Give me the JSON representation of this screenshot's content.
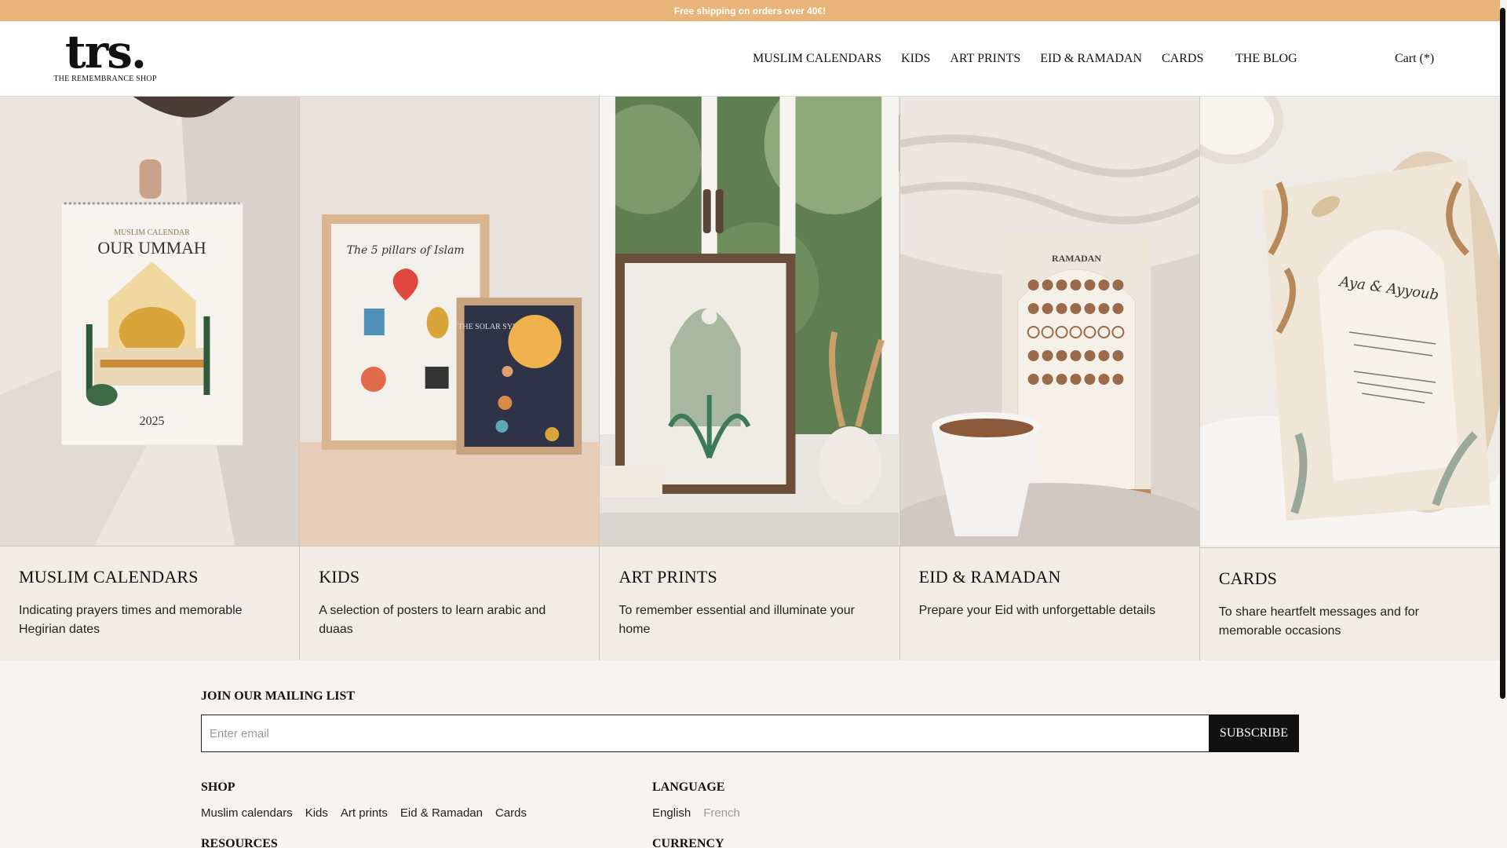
{
  "banner": {
    "text": "Free shipping on orders over 40€!"
  },
  "header": {
    "logo_mark": "trs.",
    "logo_sub": "THE REMEMBRANCE SHOP",
    "nav": [
      "MUSLIM CALENDARS",
      "KIDS",
      "ART PRINTS",
      "EID & RAMADAN",
      "CARDS"
    ],
    "blog": "THE BLOG",
    "cart": "Cart (*)"
  },
  "categories": [
    {
      "title": "MUSLIM CALENDARS",
      "desc": "Indicating prayers times and memorable Hegirian dates"
    },
    {
      "title": "KIDS",
      "desc": "A selection of posters to learn arabic and duaas"
    },
    {
      "title": "ART PRINTS",
      "desc": "To remember essential and illuminate your home"
    },
    {
      "title": "EID & RAMADAN",
      "desc": "Prepare your Eid with unforgettable details"
    },
    {
      "title": "CARDS",
      "desc": "To share heartfelt messages and for memorable occasions"
    }
  ],
  "image_text": {
    "cal_top": "MUSLIM CALENDAR",
    "cal_title": "OUR UMMAH",
    "cal_year": "2025",
    "kids_poster": "The 5 pillars of Islam",
    "kids_solar": "THE SOLAR SYSTEM",
    "ramadan": "RAMADAN",
    "card_names": "Aya & Ayyoub"
  },
  "mailing": {
    "title": "JOIN OUR MAILING LIST",
    "placeholder": "Enter email",
    "button": "SUBSCRIBE"
  },
  "footer": {
    "shop_title": "SHOP",
    "shop_links": [
      "Muslim calendars",
      "Kids",
      "Art prints",
      "Eid & Ramadan",
      "Cards"
    ],
    "language_title": "LANGUAGE",
    "languages": [
      "English",
      "French"
    ],
    "resources_title": "RESOURCES",
    "currency_title": "CURRENCY"
  }
}
